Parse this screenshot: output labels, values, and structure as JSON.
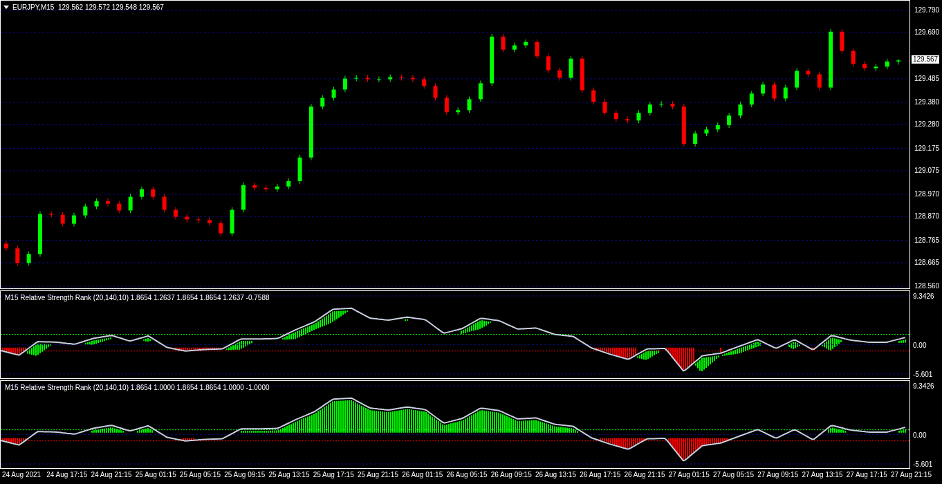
{
  "chart": {
    "header": "EURJPY,M15  129.562 129.572 129.548 129.567",
    "current_price": "129.567",
    "chart_data": {
      "type": "candlestick",
      "ylim": [
        128.551,
        129.833
      ],
      "yticks": [
        {
          "value": 129.79,
          "label": "129.790"
        },
        {
          "value": 129.69,
          "label": "129.690"
        },
        {
          "value": 129.485,
          "label": "129.485"
        },
        {
          "value": 129.38,
          "label": "129.380"
        },
        {
          "value": 129.28,
          "label": "129.280"
        },
        {
          "value": 129.175,
          "label": "129.175"
        },
        {
          "value": 129.075,
          "label": "129.075"
        },
        {
          "value": 128.97,
          "label": "128.970"
        },
        {
          "value": 128.87,
          "label": "128.870"
        },
        {
          "value": 128.765,
          "label": "128.765"
        },
        {
          "value": 128.665,
          "label": "128.665"
        },
        {
          "value": 128.56,
          "label": "128.560"
        }
      ],
      "grid": true,
      "ohlc": [
        [
          128.75,
          128.762,
          128.717,
          128.729
        ],
        [
          128.729,
          128.741,
          128.652,
          128.664
        ],
        [
          128.664,
          128.716,
          128.652,
          128.704
        ],
        [
          128.704,
          128.894,
          128.692,
          128.882
        ],
        [
          128.882,
          128.894,
          128.867,
          128.879
        ],
        [
          128.879,
          128.891,
          128.827,
          128.839
        ],
        [
          128.839,
          128.888,
          128.827,
          128.876
        ],
        [
          128.876,
          128.928,
          128.864,
          128.916
        ],
        [
          128.916,
          128.952,
          128.904,
          128.94
        ],
        [
          128.94,
          128.952,
          128.916,
          128.928
        ],
        [
          128.928,
          128.94,
          128.886,
          128.898
        ],
        [
          128.898,
          128.971,
          128.886,
          128.959
        ],
        [
          128.959,
          129.005,
          128.947,
          128.993
        ],
        [
          128.993,
          129.005,
          128.947,
          128.959
        ],
        [
          128.959,
          128.971,
          128.889,
          128.901
        ],
        [
          128.901,
          128.913,
          128.858,
          128.87
        ],
        [
          128.87,
          128.882,
          128.846,
          128.858
        ],
        [
          128.858,
          128.87,
          128.843,
          128.855
        ],
        [
          128.855,
          128.867,
          128.83,
          128.842
        ],
        [
          128.842,
          128.854,
          128.784,
          128.796
        ],
        [
          128.796,
          128.913,
          128.784,
          128.901
        ],
        [
          128.901,
          129.023,
          128.889,
          129.011
        ],
        [
          129.011,
          129.023,
          128.987,
          128.999
        ],
        [
          128.999,
          129.011,
          128.981,
          128.993
        ],
        [
          128.993,
          129.017,
          128.981,
          129.005
        ],
        [
          129.005,
          129.041,
          128.993,
          129.029
        ],
        [
          129.029,
          129.146,
          129.017,
          129.134
        ],
        [
          129.134,
          129.373,
          129.122,
          129.361
        ],
        [
          129.361,
          129.412,
          129.349,
          129.4
        ],
        [
          129.4,
          129.449,
          129.388,
          129.437
        ],
        [
          129.437,
          129.498,
          129.425,
          129.486
        ],
        [
          129.486,
          129.501,
          129.474,
          129.489
        ],
        [
          129.489,
          129.501,
          129.471,
          129.483
        ],
        [
          129.483,
          129.495,
          129.471,
          129.483
        ],
        [
          129.483,
          129.504,
          129.471,
          129.492
        ],
        [
          129.492,
          129.504,
          129.477,
          129.489
        ],
        [
          129.489,
          129.501,
          129.471,
          129.483
        ],
        [
          129.483,
          129.495,
          129.441,
          129.453
        ],
        [
          129.453,
          129.465,
          129.388,
          129.4
        ],
        [
          129.4,
          129.412,
          129.324,
          129.336
        ],
        [
          129.336,
          129.357,
          129.324,
          129.345
        ],
        [
          129.345,
          129.406,
          129.333,
          129.394
        ],
        [
          129.394,
          129.477,
          129.382,
          129.465
        ],
        [
          129.465,
          129.685,
          129.453,
          129.673
        ],
        [
          129.673,
          129.685,
          129.603,
          129.615
        ],
        [
          129.615,
          129.646,
          129.603,
          129.634
        ],
        [
          129.634,
          129.661,
          129.622,
          129.649
        ],
        [
          129.649,
          129.661,
          129.573,
          129.585
        ],
        [
          129.585,
          129.597,
          129.511,
          129.523
        ],
        [
          129.523,
          129.535,
          129.477,
          129.489
        ],
        [
          129.489,
          129.587,
          129.477,
          129.575
        ],
        [
          129.575,
          129.587,
          129.422,
          129.434
        ],
        [
          129.434,
          129.446,
          129.37,
          129.382
        ],
        [
          129.382,
          129.394,
          129.321,
          129.333
        ],
        [
          129.333,
          129.345,
          129.293,
          129.305
        ],
        [
          129.305,
          129.317,
          129.287,
          129.299
        ],
        [
          129.299,
          129.345,
          129.287,
          129.333
        ],
        [
          129.333,
          129.382,
          129.321,
          129.37
        ],
        [
          129.37,
          129.385,
          129.358,
          129.373
        ],
        [
          129.373,
          129.385,
          129.349,
          129.361
        ],
        [
          129.361,
          129.373,
          129.183,
          129.195
        ],
        [
          129.195,
          129.253,
          129.183,
          129.241
        ],
        [
          129.241,
          129.271,
          129.229,
          129.259
        ],
        [
          129.259,
          129.29,
          129.247,
          129.278
        ],
        [
          129.278,
          129.333,
          129.266,
          129.321
        ],
        [
          129.321,
          129.382,
          129.309,
          129.37
        ],
        [
          129.37,
          129.431,
          129.358,
          129.419
        ],
        [
          129.419,
          129.471,
          129.407,
          129.459
        ],
        [
          129.459,
          129.471,
          129.385,
          129.397
        ],
        [
          129.397,
          129.458,
          129.385,
          129.446
        ],
        [
          129.446,
          129.532,
          129.434,
          129.52
        ],
        [
          129.52,
          129.532,
          129.493,
          129.505
        ],
        [
          129.505,
          129.517,
          129.434,
          129.446
        ],
        [
          129.446,
          129.707,
          129.434,
          129.695
        ],
        [
          129.695,
          129.707,
          129.597,
          129.609
        ],
        [
          129.609,
          129.621,
          129.539,
          129.551
        ],
        [
          129.551,
          129.563,
          129.52,
          129.532
        ],
        [
          129.532,
          129.551,
          129.52,
          129.539
        ],
        [
          129.539,
          129.574,
          129.527,
          129.562
        ],
        [
          129.562,
          129.572,
          129.548,
          129.567
        ]
      ]
    }
  },
  "indicators": [
    {
      "title": "M15 Relative Strength Rank (20,140,10) 1.8654 1.2637 1.8654 1.8654 1.2637 -0.7588",
      "kind": "line",
      "chart_data": {
        "type": "line",
        "grid": true,
        "ylim": [
          -6.527,
          10.4
        ],
        "yticks": [
          {
            "value": 9.3426,
            "label": "9.3426"
          },
          {
            "value": 0,
            "label": "0.00"
          },
          {
            "value": -5.601,
            "label": "-5.601"
          }
        ],
        "series": [
          {
            "color": "#c8d0e0",
            "values": [
              -1.1,
              -2.0,
              0.6,
              0.5,
              0.1,
              1.2,
              1.8,
              0.7,
              1.7,
              -0.5,
              -1.2,
              -0.9,
              -0.8,
              1.1,
              1.1,
              1.2,
              2.9,
              4.4,
              6.8,
              7.0,
              5.1,
              4.7,
              5.3,
              4.8,
              2.2,
              3.1,
              5.1,
              4.6,
              3.0,
              3.2,
              2.0,
              1.6,
              -0.6,
              -1.8,
              -2.8,
              -0.8,
              -0.7,
              -5.1,
              -2.1,
              -1.6,
              -0.3,
              1.0,
              -0.7,
              1.0,
              -1.0,
              1.8,
              0.9,
              0.5,
              0.5,
              1.4
            ]
          }
        ]
      }
    },
    {
      "title": "M15 Relative Strength Rank (20,140,10) 1.8654 1.0000 1.8654 1.8654 1.0000 -1.0000",
      "kind": "histogram",
      "chart_data": {
        "type": "line",
        "grid": true,
        "ylim": [
          -6.527,
          10.4
        ],
        "yticks": [
          {
            "value": 9.3426,
            "label": "9.3426"
          },
          {
            "value": 0,
            "label": "0.00"
          },
          {
            "value": -5.601,
            "label": "-5.601"
          }
        ],
        "series": [
          {
            "color": "#c8d0e0",
            "values": [
              -1.1,
              -2.0,
              0.6,
              0.5,
              0.1,
              1.2,
              1.8,
              0.7,
              1.7,
              -0.5,
              -1.2,
              -0.9,
              -0.8,
              1.1,
              1.1,
              1.2,
              2.9,
              4.4,
              6.8,
              7.0,
              5.1,
              4.7,
              5.3,
              4.8,
              2.2,
              3.1,
              5.1,
              4.6,
              3.0,
              3.2,
              2.0,
              1.6,
              -0.6,
              -1.8,
              -2.8,
              -0.8,
              -0.7,
              -5.1,
              -2.1,
              -1.6,
              -0.3,
              1.0,
              -0.7,
              1.0,
              -1.0,
              1.8,
              0.9,
              0.5,
              0.5,
              1.4
            ]
          }
        ]
      }
    }
  ],
  "time_axis": [
    "24 Aug 2021",
    "24 Aug 17:15",
    "24 Aug 21:15",
    "25 Aug 01:15",
    "25 Aug 05:15",
    "25 Aug 09:15",
    "25 Aug 13:15",
    "25 Aug 17:15",
    "25 Aug 21:15",
    "26 Aug 01:15",
    "26 Aug 05:15",
    "26 Aug 09:15",
    "26 Aug 13:15",
    "26 Aug 17:15",
    "26 Aug 21:15",
    "27 Aug 01:15",
    "27 Aug 05:15",
    "27 Aug 09:15",
    "27 Aug 13:15",
    "27 Aug 17:15",
    "27 Aug 21:15"
  ]
}
